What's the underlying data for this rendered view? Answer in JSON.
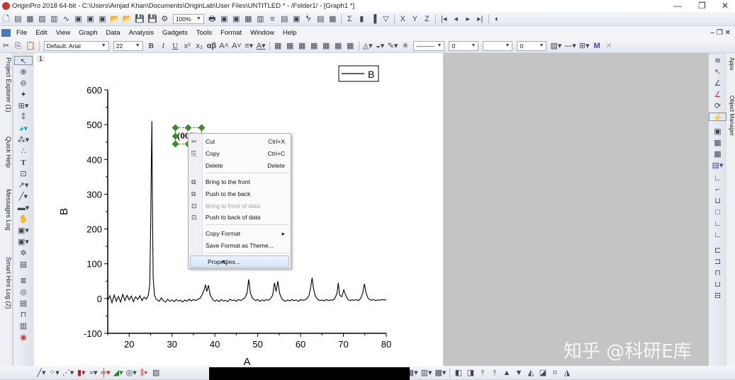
{
  "window": {
    "title": "OriginPro 2018 64-bit - C:\\Users\\Amjad Khan\\Documents\\OriginLab\\User Files\\UNTITLED * - /Folder1/ - [Graph1 *]",
    "minimize": "—",
    "restore": "❐",
    "close": "✕"
  },
  "toolbar1": {
    "zoom": "100%",
    "icons": [
      "new-project-icon",
      "new-workbook-icon",
      "new-matrix-icon",
      "new-graph-icon",
      "new-excel-icon",
      "new-function-icon",
      "new-layout-icon",
      "new-notes-icon",
      "import-icon",
      "open-icon",
      "open-template-icon",
      "save-project-icon",
      "save-template-icon",
      "recalc-icon",
      "print-icon",
      "refresh-icon",
      "duplicate-icon",
      "code-builder-icon",
      "results-log-icon",
      "command-window-icon",
      "project-explorer-icon",
      "script-window-icon",
      "data-reader-icon",
      "data-selector-icon",
      "statistics-icon"
    ],
    "axis_letters": [
      "X",
      "Y",
      "Z"
    ]
  },
  "menu": {
    "items": [
      "File",
      "Edit",
      "View",
      "Graph",
      "Data",
      "Analysis",
      "Gadgets",
      "Tools",
      "Format",
      "Window",
      "Help"
    ]
  },
  "format_toolbar": {
    "font": "Default: Arial",
    "font_size": "22",
    "bold": "B",
    "italic": "I",
    "underline": "U",
    "greek": "αβ",
    "line_width": "0",
    "pattern_width": "0"
  },
  "left_tabs": [
    "Project Explorer (1)",
    "Quick Help",
    "Messages Log",
    "Smart Hint Log (2)"
  ],
  "right_tabs": [
    "Apps",
    "Object Manager"
  ],
  "graph": {
    "layer_number": "1",
    "text_label": "(002)",
    "legend": "B"
  },
  "chart_data": {
    "type": "line",
    "xlabel": "A",
    "ylabel": "B",
    "xlim": [
      15,
      80
    ],
    "ylim": [
      -100,
      600
    ],
    "xticks": [
      20,
      30,
      40,
      50,
      60,
      70,
      80
    ],
    "yticks": [
      -100,
      0,
      100,
      200,
      300,
      400,
      500,
      600
    ],
    "series": [
      {
        "name": "B",
        "color": "#000000",
        "points": [
          [
            15,
            -5
          ],
          [
            15.5,
            8
          ],
          [
            16,
            -12
          ],
          [
            16.5,
            10
          ],
          [
            17,
            -8
          ],
          [
            17.5,
            6
          ],
          [
            18,
            -10
          ],
          [
            18.5,
            12
          ],
          [
            19,
            -6
          ],
          [
            19.5,
            9
          ],
          [
            20,
            -4
          ],
          [
            20.5,
            7
          ],
          [
            21,
            -9
          ],
          [
            21.5,
            5
          ],
          [
            22,
            -3
          ],
          [
            22.5,
            8
          ],
          [
            23,
            -6
          ],
          [
            23.5,
            4
          ],
          [
            24,
            -2
          ],
          [
            24.5,
            10
          ],
          [
            24.8,
            40
          ],
          [
            25.0,
            200
          ],
          [
            25.2,
            420
          ],
          [
            25.3,
            510
          ],
          [
            25.4,
            300
          ],
          [
            25.6,
            60
          ],
          [
            25.9,
            10
          ],
          [
            26.3,
            -2
          ],
          [
            27,
            -8
          ],
          [
            27.5,
            2
          ],
          [
            28,
            -6
          ],
          [
            28.5,
            -10
          ],
          [
            29,
            -2
          ],
          [
            29.5,
            -8
          ],
          [
            30,
            -4
          ],
          [
            30.5,
            -9
          ],
          [
            31,
            -3
          ],
          [
            31.5,
            -7
          ],
          [
            32,
            -5
          ],
          [
            32.5,
            -10
          ],
          [
            33,
            -4
          ],
          [
            33.5,
            -8
          ],
          [
            34,
            -2
          ],
          [
            34.5,
            -7
          ],
          [
            35,
            -3
          ],
          [
            35.5,
            -6
          ],
          [
            36,
            -2
          ],
          [
            36.5,
            0
          ],
          [
            37,
            10
          ],
          [
            37.5,
            25
          ],
          [
            37.8,
            40
          ],
          [
            38.1,
            20
          ],
          [
            38.5,
            38
          ],
          [
            38.9,
            10
          ],
          [
            39.5,
            -3
          ],
          [
            40,
            -8
          ],
          [
            40.5,
            -4
          ],
          [
            41,
            -9
          ],
          [
            41.5,
            -3
          ],
          [
            42,
            -7
          ],
          [
            42.5,
            -5
          ],
          [
            43,
            -9
          ],
          [
            43.5,
            -2
          ],
          [
            44,
            -6
          ],
          [
            44.5,
            -4
          ],
          [
            45,
            -8
          ],
          [
            45.5,
            -3
          ],
          [
            46,
            -6
          ],
          [
            46.5,
            -2
          ],
          [
            47,
            2
          ],
          [
            47.5,
            15
          ],
          [
            47.9,
            55
          ],
          [
            48.3,
            15
          ],
          [
            48.8,
            0
          ],
          [
            49.5,
            -6
          ],
          [
            50,
            -3
          ],
          [
            50.5,
            -8
          ],
          [
            51,
            -4
          ],
          [
            51.5,
            -7
          ],
          [
            52,
            -3
          ],
          [
            52.5,
            -5
          ],
          [
            53,
            0
          ],
          [
            53.5,
            10
          ],
          [
            53.9,
            45
          ],
          [
            54.3,
            20
          ],
          [
            54.7,
            50
          ],
          [
            55.1,
            15
          ],
          [
            55.6,
            0
          ],
          [
            56,
            -5
          ],
          [
            56.5,
            -8
          ],
          [
            57,
            -4
          ],
          [
            57.5,
            -7
          ],
          [
            58,
            -3
          ],
          [
            58.5,
            -6
          ],
          [
            59,
            -4
          ],
          [
            59.5,
            -8
          ],
          [
            60,
            -3
          ],
          [
            60.5,
            -5
          ],
          [
            61,
            -4
          ],
          [
            61.5,
            0
          ],
          [
            62,
            10
          ],
          [
            62.4,
            35
          ],
          [
            62.7,
            60
          ],
          [
            63,
            30
          ],
          [
            63.4,
            8
          ],
          [
            64,
            -3
          ],
          [
            64.5,
            -6
          ],
          [
            65,
            -4
          ],
          [
            65.5,
            -7
          ],
          [
            66,
            -3
          ],
          [
            66.5,
            -6
          ],
          [
            67,
            -4
          ],
          [
            67.5,
            -5
          ],
          [
            68,
            0
          ],
          [
            68.5,
            15
          ],
          [
            68.8,
            45
          ],
          [
            69.1,
            10
          ],
          [
            69.6,
            5
          ],
          [
            70.1,
            25
          ],
          [
            70.5,
            10
          ],
          [
            71,
            -2
          ],
          [
            71.5,
            -6
          ],
          [
            72,
            -4
          ],
          [
            72.5,
            -5
          ],
          [
            73,
            -3
          ],
          [
            73.5,
            -6
          ],
          [
            74,
            0
          ],
          [
            74.5,
            15
          ],
          [
            74.9,
            42
          ],
          [
            75.3,
            15
          ],
          [
            75.8,
            0
          ],
          [
            76.5,
            -5
          ],
          [
            77,
            -3
          ],
          [
            77.5,
            -6
          ],
          [
            78,
            -4
          ],
          [
            78.5,
            -5
          ],
          [
            79,
            -3
          ],
          [
            79.5,
            -4
          ],
          [
            80,
            -4
          ]
        ]
      }
    ]
  },
  "context_menu": {
    "items": [
      {
        "label": "Cut",
        "shortcut": "Ctrl+X",
        "icon": "scissors-icon"
      },
      {
        "label": "Copy",
        "shortcut": "Ctrl+C",
        "icon": "copy-icon"
      },
      {
        "label": "Delete",
        "shortcut": "Delete"
      },
      {
        "label": "Bring to the front",
        "icon": "bring-front-icon"
      },
      {
        "label": "Push to the back",
        "icon": "push-back-icon"
      },
      {
        "label": "Bring to front of data",
        "icon": "bring-front-data-icon",
        "disabled": true
      },
      {
        "label": "Push to back of data",
        "icon": "push-back-data-icon"
      },
      {
        "label": "Copy Format",
        "submenu": "▸"
      },
      {
        "label": "Save Format as Theme..."
      },
      {
        "label": "Properties...",
        "highlighted": true
      }
    ]
  },
  "watermark": "知乎 @科研E库"
}
